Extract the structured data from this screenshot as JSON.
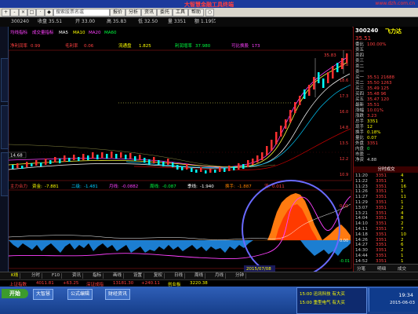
{
  "window": {
    "title": "大智慧金融工具终端",
    "corner_text": "www.dzh.com.cn"
  },
  "toolbar": {
    "buttons": [
      "+",
      "-",
      "×",
      "□",
      "·",
      "◆",
      "○"
    ],
    "search_placeholder": "搜索股票名或",
    "menu_items": [
      "报价",
      "分析",
      "资讯",
      "委托",
      "工具",
      "帮助"
    ]
  },
  "stock_tabs": [
    {
      "label": "300240",
      "color": "#ffffff"
    },
    {
      "label": "收盘 35.51",
      "color": "#ffff00"
    },
    {
      "label": "开 33.00",
      "color": "#ff4040"
    },
    {
      "label": "高 35.83",
      "color": "#ff4040"
    },
    {
      "label": "低 32.50",
      "color": "#00ff40"
    },
    {
      "label": "量 3351",
      "color": "#ffff00"
    },
    {
      "label": "额 1.19亿",
      "color": "#00ccff"
    }
  ],
  "indicator_tags": [
    "均线指标",
    "成交量指标",
    "MA5",
    "MA10",
    "MA20",
    "MA60"
  ],
  "chart_header": [
    {
      "label": "净利润率",
      "value": "0.99",
      "color": "#ff4040"
    },
    {
      "label": "毛利率",
      "value": "0.06",
      "color": "#ff4040"
    },
    {
      "label": "流通盘",
      "value": "1.825",
      "color": "#ffff00"
    },
    {
      "label": "利润增率",
      "value": "37.980",
      "color": "#00ff40"
    },
    {
      "label": "可比换股",
      "value": "173",
      "color": "#ff40ff"
    }
  ],
  "price_marker": "14.68",
  "price_top": "35.83",
  "indicator_line": [
    {
      "label": "主力合力",
      "color": "#ff4040"
    },
    {
      "label": "资金:",
      "value": "-7.881",
      "color": "#ffff00"
    },
    {
      "label": "二级:",
      "value": "-1.481",
      "color": "#00ccff"
    },
    {
      "label": "月线:",
      "value": "-0.0882",
      "color": "#ff40ff"
    },
    {
      "label": "周线:",
      "value": "-0.087",
      "color": "#00ff40"
    },
    {
      "label": "季线:",
      "value": "-1.940",
      "color": "#ffffff"
    },
    {
      "label": "换手:",
      "value": "-1.887",
      "color": "#ff8000"
    },
    {
      "label": "流:",
      "value": "0.011",
      "color": "#ff4040"
    }
  ],
  "axis_left": [
    "4.81",
    "4.32",
    "3.92",
    "3.59",
    "3.20",
    "2.80",
    "2.41"
  ],
  "axis_right_upper": [
    "19.8",
    "18.6",
    "17.3",
    "16.0",
    "14.8",
    "13.5",
    "12.2",
    "10.9"
  ],
  "axis_right_lower": [
    "0.01",
    "0.00",
    "-0.01"
  ],
  "date_label": "2015/07/08",
  "bottom_tabs": [
    "K线",
    "分时",
    "F10",
    "资讯",
    "指标",
    "画线",
    "设置",
    "复权",
    "日线",
    "周线",
    "月线",
    "分钟"
  ],
  "quote_strip": [
    {
      "text": "上证指数",
      "color": "#ff4040"
    },
    {
      "text": "4011.81",
      "color": "#ff4040"
    },
    {
      "text": "+63.25",
      "color": "#ff4040"
    },
    {
      "text": "深证成指",
      "color": "#ff4040"
    },
    {
      "text": "13181.30",
      "color": "#ff4040"
    },
    {
      "text": "+240.11",
      "color": "#ff4040"
    },
    {
      "text": "创业板",
      "color": "#ffff00"
    },
    {
      "text": "3220.38",
      "color": "#ffff00"
    }
  ],
  "right_panel": {
    "code": "300240",
    "name": "飞力达",
    "price": "35.51",
    "rows": [
      {
        "k": "委比",
        "v": "100.00%",
        "c": "#ff4040"
      },
      {
        "k": "卖五",
        "v": "",
        "c": "#ccc"
      },
      {
        "k": "卖四",
        "v": "",
        "c": "#ccc"
      },
      {
        "k": "卖三",
        "v": "",
        "c": "#ccc"
      },
      {
        "k": "卖二",
        "v": "",
        "c": "#ccc"
      },
      {
        "k": "卖一",
        "v": "",
        "c": "#ccc"
      },
      {
        "k": "买一",
        "v": "35.51 21688",
        "c": "#ff4040"
      },
      {
        "k": "买二",
        "v": "35.50  1263",
        "c": "#ff4040"
      },
      {
        "k": "买三",
        "v": "35.49   125",
        "c": "#ff4040"
      },
      {
        "k": "买四",
        "v": "35.48    96",
        "c": "#ff4040"
      },
      {
        "k": "买五",
        "v": "35.47   120",
        "c": "#ff4040"
      },
      {
        "k": "最新",
        "v": "35.51",
        "c": "#ff4040"
      },
      {
        "k": "涨幅",
        "v": "10.01%",
        "c": "#ff4040"
      },
      {
        "k": "涨跌",
        "v": "3.23",
        "c": "#ff4040"
      },
      {
        "k": "总手",
        "v": "3351",
        "c": "#ffff00"
      },
      {
        "k": "现手",
        "v": "12",
        "c": "#ffff00"
      },
      {
        "k": "换手",
        "v": "0.18%",
        "c": "#ffff00"
      },
      {
        "k": "量比",
        "v": "0.07",
        "c": "#ffff00"
      },
      {
        "k": "外盘",
        "v": "3351",
        "c": "#ff4040"
      },
      {
        "k": "内盘",
        "v": "0",
        "c": "#00ff40"
      },
      {
        "k": "市盈",
        "v": "--",
        "c": "#ccc"
      },
      {
        "k": "净资",
        "v": "4.88",
        "c": "#ccc"
      }
    ],
    "ticks_header": "分时成交",
    "ticks": [
      {
        "t": "11:20",
        "p": "3351",
        "v": "4"
      },
      {
        "t": "11:22",
        "p": "3351",
        "v": "3"
      },
      {
        "t": "11:23",
        "p": "3351",
        "v": "16"
      },
      {
        "t": "11:26",
        "p": "3351",
        "v": "1"
      },
      {
        "t": "11:27",
        "p": "3351",
        "v": "11"
      },
      {
        "t": "11:29",
        "p": "3351",
        "v": "1"
      },
      {
        "t": "13:07",
        "p": "3351",
        "v": "2"
      },
      {
        "t": "13:21",
        "p": "3351",
        "v": "4"
      },
      {
        "t": "14:04",
        "p": "3351",
        "v": "8"
      },
      {
        "t": "14:10",
        "p": "3351",
        "v": "2"
      },
      {
        "t": "14:11",
        "p": "3351",
        "v": "7"
      },
      {
        "t": "14:18",
        "p": "3351",
        "v": "10"
      },
      {
        "t": "14:26",
        "p": "3351",
        "v": "2"
      },
      {
        "t": "14:27",
        "p": "3351",
        "v": "6"
      },
      {
        "t": "14:30",
        "p": "3351",
        "v": "2"
      },
      {
        "t": "14:44",
        "p": "3351",
        "v": "1"
      },
      {
        "t": "14:52",
        "p": "3351",
        "v": "1"
      }
    ],
    "footer": [
      "分笔",
      "明细",
      "成交"
    ]
  },
  "taskbar": {
    "start": "开始",
    "items": [
      "大智慧",
      "公式编辑",
      "财经资讯"
    ],
    "notify": [
      {
        "text": "15:00 迅讯科技 有大买",
        "color": "#ffff00"
      },
      {
        "text": "15:00 重型电气 有大买",
        "color": "#ffff00"
      }
    ],
    "time": "19:34",
    "date": "2015-06-03"
  }
}
